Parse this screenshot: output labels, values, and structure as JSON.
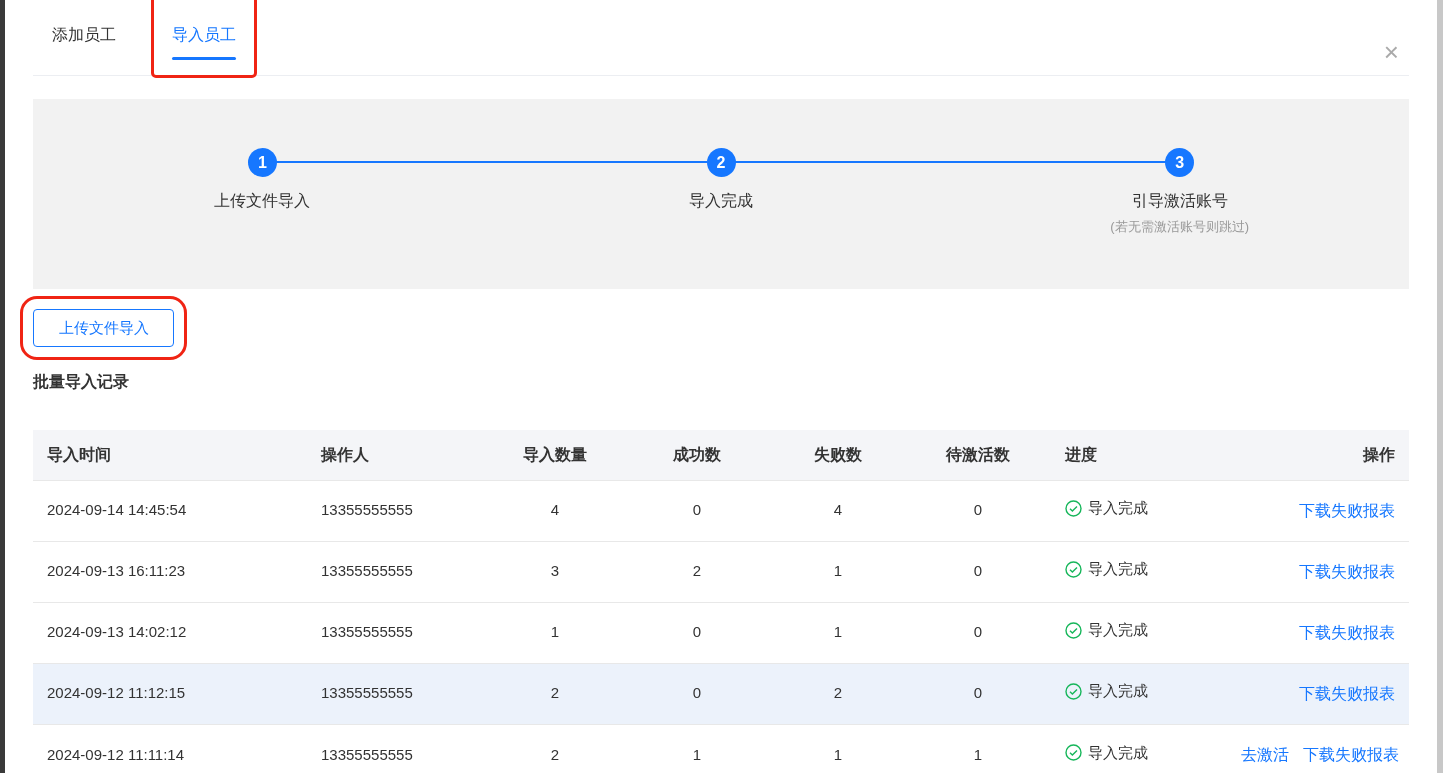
{
  "tabs": [
    {
      "label": "添加员工",
      "selected": false,
      "highlighted": false
    },
    {
      "label": "导入员工",
      "selected": true,
      "highlighted": true
    }
  ],
  "close": "×",
  "steps": [
    {
      "number": "1",
      "label": "上传文件导入"
    },
    {
      "number": "2",
      "label": "导入完成"
    },
    {
      "number": "3",
      "label": "引导激活账号",
      "note": "(若无需激活账号则跳过)"
    }
  ],
  "upload_button": {
    "label": "上传文件导入",
    "highlighted": true
  },
  "section_title": "批量导入记录",
  "table": {
    "columns": [
      "导入时间",
      "操作人",
      "导入数量",
      "成功数",
      "失败数",
      "待激活数",
      "进度",
      "操作"
    ],
    "rows": [
      {
        "time": "2024-09-14 14:45:54",
        "operator": "13355555555",
        "count": "4",
        "success": "0",
        "failed": "4",
        "pending": "0",
        "status": "导入完成",
        "actions": [
          "下载失败报表"
        ],
        "highlighted": false
      },
      {
        "time": "2024-09-13 16:11:23",
        "operator": "13355555555",
        "count": "3",
        "success": "2",
        "failed": "1",
        "pending": "0",
        "status": "导入完成",
        "actions": [
          "下载失败报表"
        ],
        "highlighted": false
      },
      {
        "time": "2024-09-13 14:02:12",
        "operator": "13355555555",
        "count": "1",
        "success": "0",
        "failed": "1",
        "pending": "0",
        "status": "导入完成",
        "actions": [
          "下载失败报表"
        ],
        "highlighted": false
      },
      {
        "time": "2024-09-12 11:12:15",
        "operator": "13355555555",
        "count": "2",
        "success": "0",
        "failed": "2",
        "pending": "0",
        "status": "导入完成",
        "actions": [
          "下载失败报表"
        ],
        "highlighted": true
      },
      {
        "time": "2024-09-12 11:11:14",
        "operator": "13355555555",
        "count": "2",
        "success": "1",
        "failed": "1",
        "pending": "1",
        "status": "导入完成",
        "actions": [
          "去激活",
          "下载失败报表"
        ],
        "highlighted": false
      }
    ]
  }
}
